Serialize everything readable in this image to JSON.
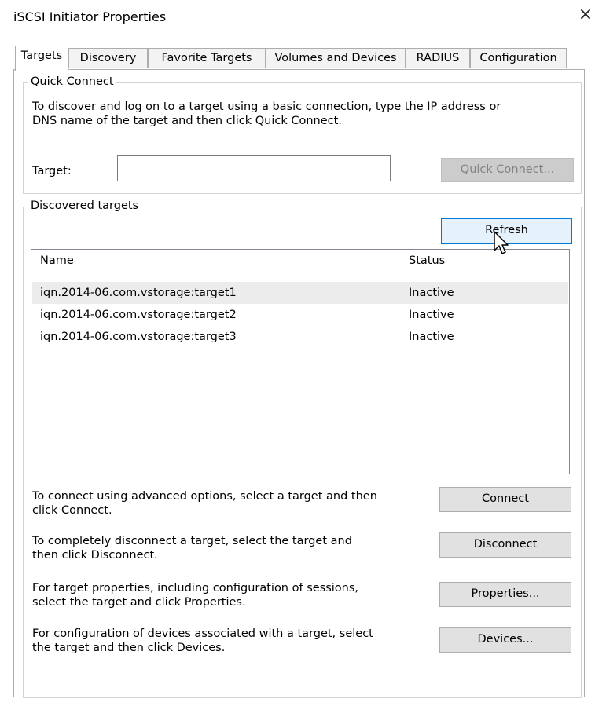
{
  "window": {
    "title": "iSCSI Initiator Properties",
    "close_glyph": "×"
  },
  "tabs": [
    {
      "label": "Targets",
      "active": true
    },
    {
      "label": "Discovery",
      "active": false
    },
    {
      "label": "Favorite Targets",
      "active": false
    },
    {
      "label": "Volumes and Devices",
      "active": false
    },
    {
      "label": "RADIUS",
      "active": false
    },
    {
      "label": "Configuration",
      "active": false
    }
  ],
  "quick_connect": {
    "legend": "Quick Connect",
    "line1": "To discover and log on to a target using a basic connection, type the IP address or",
    "line2": "DNS name of the target and then click Quick Connect.",
    "target_label": "Target:",
    "target_value": "",
    "button": "Quick Connect..."
  },
  "discovered": {
    "legend": "Discovered targets",
    "refresh_button": "Refresh",
    "columns": {
      "name": "Name",
      "status": "Status"
    },
    "rows": [
      {
        "name": "iqn.2014-06.com.vstorage:target1",
        "status": "Inactive"
      },
      {
        "name": "iqn.2014-06.com.vstorage:target2",
        "status": "Inactive"
      },
      {
        "name": "iqn.2014-06.com.vstorage:target3",
        "status": "Inactive"
      }
    ]
  },
  "actions": [
    {
      "line1": "To connect using advanced options, select a target and then",
      "line2": "click Connect.",
      "button": "Connect"
    },
    {
      "line1": "To completely disconnect a target, select the target and",
      "line2": "then click Disconnect.",
      "button": "Disconnect"
    },
    {
      "line1": "For target properties, including configuration of sessions,",
      "line2": "select the target and click Properties.",
      "button": "Properties..."
    },
    {
      "line1": "For configuration of devices associated with a target, select",
      "line2": "the target and then click Devices.",
      "button": "Devices..."
    }
  ]
}
